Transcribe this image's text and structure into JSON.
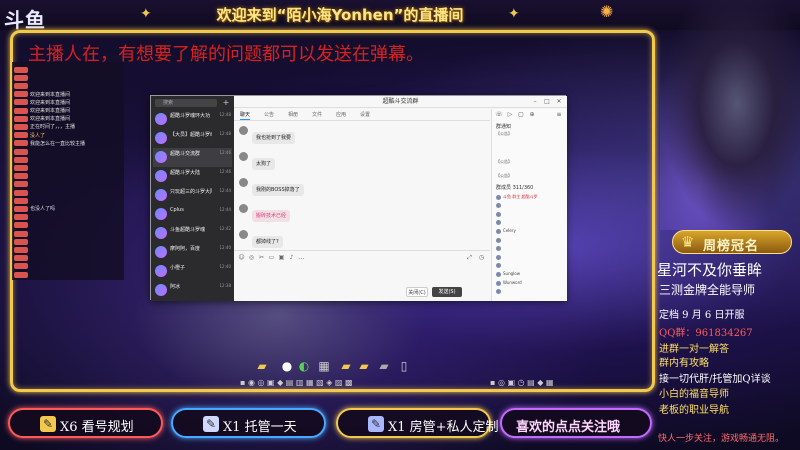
{
  "header": {
    "logo": "斗鱼",
    "title": "欢迎来到“陌小海Yonhen”的直播间"
  },
  "banner_message": "主播人在，有想要了解的问题都可以发送在弹幕。",
  "danmaku": [
    {
      "nick": "",
      "text": "",
      "sys": false
    },
    {
      "nick": "",
      "text": "",
      "sys": false
    },
    {
      "nick": "",
      "text": "",
      "sys": false
    },
    {
      "nick": "",
      "text": "欢迎来到本直播间",
      "sys": false
    },
    {
      "nick": "",
      "text": "欢迎来到本直播间",
      "sys": false
    },
    {
      "nick": "",
      "text": "欢迎来到本直播间",
      "sys": false
    },
    {
      "nick": "",
      "text": "欢迎来到本直播间",
      "sys": false
    },
    {
      "nick": "",
      "text": "正在时间了，，，主播",
      "sys": false
    },
    {
      "nick": "",
      "text": "没人了",
      "sys": true
    },
    {
      "nick": "",
      "text": "我能怎么在一直比较主播",
      "sys": false
    },
    {
      "nick": "",
      "text": "",
      "sys": false
    },
    {
      "nick": "",
      "text": "",
      "sys": false
    },
    {
      "nick": "",
      "text": "",
      "sys": false
    },
    {
      "nick": "",
      "text": "",
      "sys": false
    },
    {
      "nick": "",
      "text": "",
      "sys": false
    },
    {
      "nick": "",
      "text": "",
      "sys": false
    },
    {
      "nick": "",
      "text": "",
      "sys": false
    },
    {
      "nick": "",
      "text": "也没人了吗",
      "sys": false
    },
    {
      "nick": "",
      "text": "",
      "sys": false
    },
    {
      "nick": "",
      "text": "",
      "sys": false
    },
    {
      "nick": "",
      "text": "",
      "sys": true
    },
    {
      "nick": "",
      "text": "",
      "sys": true
    },
    {
      "nick": "",
      "text": "",
      "sys": false
    },
    {
      "nick": "",
      "text": "",
      "sys": false
    },
    {
      "nick": "",
      "text": "",
      "sys": false
    },
    {
      "nick": "",
      "text": "",
      "sys": false
    }
  ],
  "qq": {
    "title": "超酷斗交流群",
    "search_placeholder": "搜索",
    "chats": [
      {
        "name": "超酷斗罗魂环大功",
        "time": "12:48",
        "preview": "",
        "active": false
      },
      {
        "name": "【大员】超酷斗罗魂",
        "time": "12:48",
        "preview": "",
        "active": false
      },
      {
        "name": "超酷斗交流群",
        "time": "12:46",
        "preview": "",
        "active": true
      },
      {
        "name": "超酷斗罗大陆",
        "time": "12:46",
        "preview": "",
        "active": false
      },
      {
        "name": "只玩超三的斗罗大陆",
        "time": "12:44",
        "preview": "",
        "active": false
      },
      {
        "name": "Cplus",
        "time": "12:44",
        "preview": "",
        "active": false
      },
      {
        "name": "斗鱼超酷斗罗魂",
        "time": "12:42",
        "preview": "",
        "active": false
      },
      {
        "name": "摩阿阿，百度",
        "time": "12:40",
        "preview": "",
        "active": false
      },
      {
        "name": "小橙子",
        "time": "12:40",
        "preview": "",
        "active": false
      },
      {
        "name": "阿冰",
        "time": "12:38",
        "preview": "",
        "active": false
      }
    ],
    "tabs": [
      "聊天",
      "公告",
      "相册",
      "文件",
      "应用",
      "设置"
    ],
    "messages": [
      {
        "nick": "",
        "text": "我也抢到了我要",
        "pink": false
      },
      {
        "nick": "",
        "text": "太狗了",
        "pink": false
      },
      {
        "nick": "",
        "text": "我刚的BOSS掉落了",
        "pink": false
      },
      {
        "nick": "",
        "text": "搬砖技术已经",
        "pink": true
      },
      {
        "nick": "",
        "text": "都掉线了?",
        "pink": false
      }
    ],
    "close_label": "关闭(C)",
    "send_label": "发送(S)",
    "announcement_title": "群通知",
    "announcements": [
      "【公告】",
      "",
      "",
      "",
      "【公告】",
      "",
      "【公告】"
    ],
    "member_count": "群成员 311/360",
    "members": [
      {
        "name": "斗鱼 群主 超酷斗罗",
        "color": "red"
      },
      {
        "name": "",
        "color": "normal"
      },
      {
        "name": "",
        "color": "normal"
      },
      {
        "name": "",
        "color": "red"
      },
      {
        "name": "Celery",
        "color": "normal"
      },
      {
        "name": "",
        "color": "pink"
      },
      {
        "name": "",
        "color": "normal"
      },
      {
        "name": "",
        "color": "normal"
      },
      {
        "name": "",
        "color": "normal"
      },
      {
        "name": "Sunglow",
        "color": "normal"
      },
      {
        "name": "Wunword",
        "color": "normal"
      },
      {
        "name": "",
        "color": "normal"
      }
    ]
  },
  "right_panel": {
    "crown_label": "周榜冠名",
    "rank_name": "星河不及你垂眸",
    "info_lines": [
      {
        "text": "三测金牌全能导师",
        "color": "#ffffff"
      },
      {
        "text": "定档 9 月 6 日开服",
        "color": "#ffffff"
      },
      {
        "text": "QQ群：961834267",
        "color": "#ff5a5a"
      },
      {
        "text": "进群一对一解答",
        "color": "#ffe066"
      },
      {
        "text": "群内有攻略",
        "color": "#ffe066"
      },
      {
        "text": "接一切代肝/托管加Q详谈",
        "color": "#ffffff"
      },
      {
        "text": "小白的福音导师",
        "color": "#ffe066"
      },
      {
        "text": "老板的职业导航",
        "color": "#ffe066"
      }
    ],
    "footer_note": "快人一步关注，游戏畅通无阻。"
  },
  "bottom_buttons": [
    {
      "label": "X6 看号规划",
      "border": "#ff5a5a"
    },
    {
      "label": "X1 托管一天",
      "border": "#4aa8ff"
    },
    {
      "label": "X1 房管+私人定制",
      "border": "#f2c94c"
    },
    {
      "label": "喜欢的点点关注哦",
      "border": "#c26bff"
    }
  ],
  "colors": {
    "frame_gold": "#f2c94c",
    "banner_red": "#d82020",
    "qq_send": "#444444"
  }
}
